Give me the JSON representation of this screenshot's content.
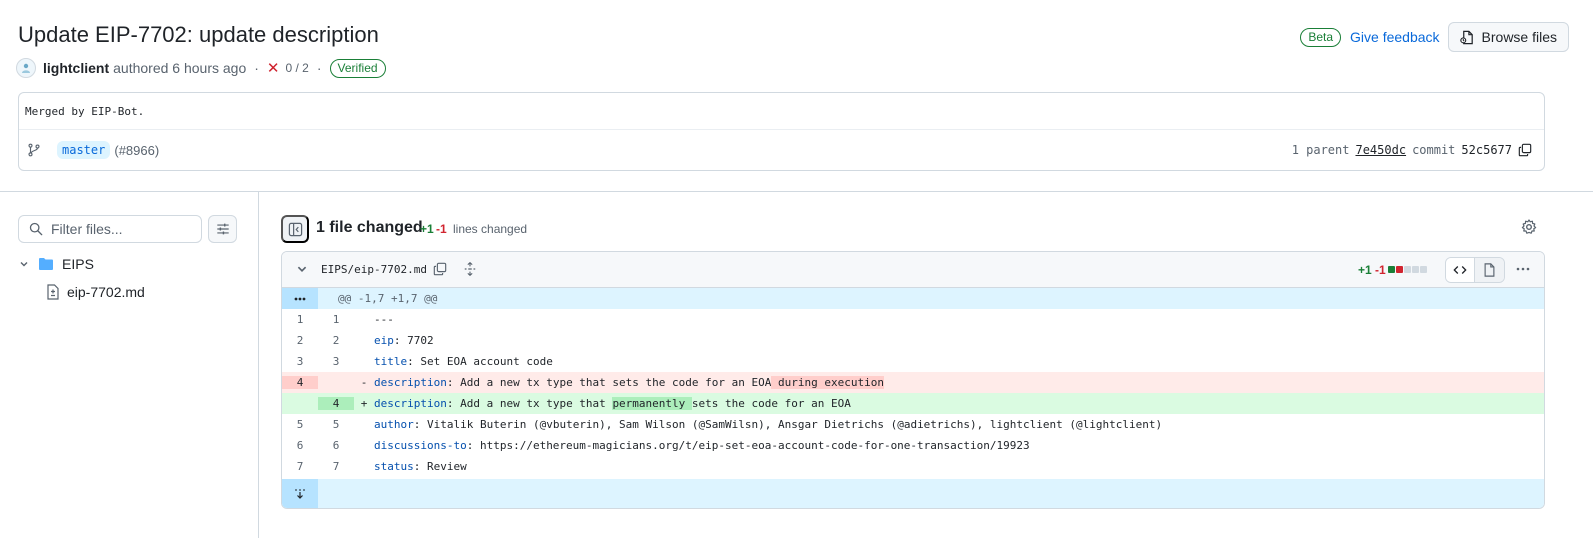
{
  "header": {
    "title": "Update EIP-7702: update description",
    "author": "lightclient",
    "authored_text": "authored 6 hours ago",
    "separator": "·",
    "checks": "0 / 2",
    "verified_label": "Verified",
    "beta_label": "Beta",
    "feedback_label": "Give feedback",
    "browse_label": "Browse files"
  },
  "commit": {
    "message": "Merged by EIP-Bot.",
    "branch": "master",
    "pr_ref": "(#8966)",
    "parent_label": "1 parent",
    "parent_sha": "7e450dc",
    "commit_label": "commit",
    "commit_sha": "52c5677"
  },
  "sidebar": {
    "filter_placeholder": "Filter files...",
    "folder": "EIPS",
    "file": "eip-7702.md"
  },
  "summary": {
    "files_changed": "1 file changed",
    "additions": "+1",
    "deletions": "-1",
    "lines_changed": "lines changed"
  },
  "file": {
    "path": "EIPS/eip-7702.md",
    "additions": "+1",
    "deletions": "-1",
    "hunk_header": "@@ -1,7 +1,7 @@",
    "lines": [
      {
        "old": "1",
        "new": "1",
        "sign": "",
        "key": "",
        "text": "---"
      },
      {
        "old": "2",
        "new": "2",
        "sign": "",
        "key": "eip",
        "text": ": 7702"
      },
      {
        "old": "3",
        "new": "3",
        "sign": "",
        "key": "title",
        "text": ": Set EOA account code"
      },
      {
        "old": "4",
        "new": "",
        "sign": "-",
        "key": "description",
        "text": ": Add a new tx type that sets the code for an EOA",
        "highlight": " during execution"
      },
      {
        "old": "",
        "new": "4",
        "sign": "+",
        "key": "description",
        "text_pre": ": Add a new tx type that ",
        "highlight": "permanently ",
        "text_post": "sets the code for an EOA"
      },
      {
        "old": "5",
        "new": "5",
        "sign": "",
        "key": "author",
        "text": ": Vitalik Buterin (@vbuterin), Sam Wilson (@SamWilsn), Ansgar Dietrichs (@adietrichs), lightclient (@lightclient)"
      },
      {
        "old": "6",
        "new": "6",
        "sign": "",
        "key": "discussions-to",
        "text": ": https://ethereum-magicians.org/t/eip-set-eoa-account-code-for-one-transaction/19923"
      },
      {
        "old": "7",
        "new": "7",
        "sign": "",
        "key": "status",
        "text": ": Review"
      }
    ]
  },
  "colors": {
    "addition": "#1a7f37",
    "deletion": "#d1242f",
    "link": "#0969da"
  }
}
